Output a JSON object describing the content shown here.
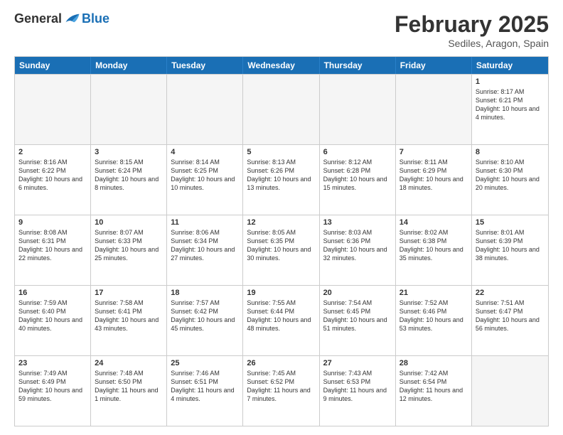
{
  "header": {
    "logo_general": "General",
    "logo_blue": "Blue",
    "month_title": "February 2025",
    "subtitle": "Sediles, Aragon, Spain"
  },
  "days_of_week": [
    "Sunday",
    "Monday",
    "Tuesday",
    "Wednesday",
    "Thursday",
    "Friday",
    "Saturday"
  ],
  "weeks": [
    [
      {
        "day": "",
        "empty": true
      },
      {
        "day": "",
        "empty": true
      },
      {
        "day": "",
        "empty": true
      },
      {
        "day": "",
        "empty": true
      },
      {
        "day": "",
        "empty": true
      },
      {
        "day": "",
        "empty": true
      },
      {
        "day": "1",
        "sunrise": "Sunrise: 8:17 AM",
        "sunset": "Sunset: 6:21 PM",
        "daylight": "Daylight: 10 hours and 4 minutes."
      }
    ],
    [
      {
        "day": "2",
        "sunrise": "Sunrise: 8:16 AM",
        "sunset": "Sunset: 6:22 PM",
        "daylight": "Daylight: 10 hours and 6 minutes."
      },
      {
        "day": "3",
        "sunrise": "Sunrise: 8:15 AM",
        "sunset": "Sunset: 6:24 PM",
        "daylight": "Daylight: 10 hours and 8 minutes."
      },
      {
        "day": "4",
        "sunrise": "Sunrise: 8:14 AM",
        "sunset": "Sunset: 6:25 PM",
        "daylight": "Daylight: 10 hours and 10 minutes."
      },
      {
        "day": "5",
        "sunrise": "Sunrise: 8:13 AM",
        "sunset": "Sunset: 6:26 PM",
        "daylight": "Daylight: 10 hours and 13 minutes."
      },
      {
        "day": "6",
        "sunrise": "Sunrise: 8:12 AM",
        "sunset": "Sunset: 6:28 PM",
        "daylight": "Daylight: 10 hours and 15 minutes."
      },
      {
        "day": "7",
        "sunrise": "Sunrise: 8:11 AM",
        "sunset": "Sunset: 6:29 PM",
        "daylight": "Daylight: 10 hours and 18 minutes."
      },
      {
        "day": "8",
        "sunrise": "Sunrise: 8:10 AM",
        "sunset": "Sunset: 6:30 PM",
        "daylight": "Daylight: 10 hours and 20 minutes."
      }
    ],
    [
      {
        "day": "9",
        "sunrise": "Sunrise: 8:08 AM",
        "sunset": "Sunset: 6:31 PM",
        "daylight": "Daylight: 10 hours and 22 minutes."
      },
      {
        "day": "10",
        "sunrise": "Sunrise: 8:07 AM",
        "sunset": "Sunset: 6:33 PM",
        "daylight": "Daylight: 10 hours and 25 minutes."
      },
      {
        "day": "11",
        "sunrise": "Sunrise: 8:06 AM",
        "sunset": "Sunset: 6:34 PM",
        "daylight": "Daylight: 10 hours and 27 minutes."
      },
      {
        "day": "12",
        "sunrise": "Sunrise: 8:05 AM",
        "sunset": "Sunset: 6:35 PM",
        "daylight": "Daylight: 10 hours and 30 minutes."
      },
      {
        "day": "13",
        "sunrise": "Sunrise: 8:03 AM",
        "sunset": "Sunset: 6:36 PM",
        "daylight": "Daylight: 10 hours and 32 minutes."
      },
      {
        "day": "14",
        "sunrise": "Sunrise: 8:02 AM",
        "sunset": "Sunset: 6:38 PM",
        "daylight": "Daylight: 10 hours and 35 minutes."
      },
      {
        "day": "15",
        "sunrise": "Sunrise: 8:01 AM",
        "sunset": "Sunset: 6:39 PM",
        "daylight": "Daylight: 10 hours and 38 minutes."
      }
    ],
    [
      {
        "day": "16",
        "sunrise": "Sunrise: 7:59 AM",
        "sunset": "Sunset: 6:40 PM",
        "daylight": "Daylight: 10 hours and 40 minutes."
      },
      {
        "day": "17",
        "sunrise": "Sunrise: 7:58 AM",
        "sunset": "Sunset: 6:41 PM",
        "daylight": "Daylight: 10 hours and 43 minutes."
      },
      {
        "day": "18",
        "sunrise": "Sunrise: 7:57 AM",
        "sunset": "Sunset: 6:42 PM",
        "daylight": "Daylight: 10 hours and 45 minutes."
      },
      {
        "day": "19",
        "sunrise": "Sunrise: 7:55 AM",
        "sunset": "Sunset: 6:44 PM",
        "daylight": "Daylight: 10 hours and 48 minutes."
      },
      {
        "day": "20",
        "sunrise": "Sunrise: 7:54 AM",
        "sunset": "Sunset: 6:45 PM",
        "daylight": "Daylight: 10 hours and 51 minutes."
      },
      {
        "day": "21",
        "sunrise": "Sunrise: 7:52 AM",
        "sunset": "Sunset: 6:46 PM",
        "daylight": "Daylight: 10 hours and 53 minutes."
      },
      {
        "day": "22",
        "sunrise": "Sunrise: 7:51 AM",
        "sunset": "Sunset: 6:47 PM",
        "daylight": "Daylight: 10 hours and 56 minutes."
      }
    ],
    [
      {
        "day": "23",
        "sunrise": "Sunrise: 7:49 AM",
        "sunset": "Sunset: 6:49 PM",
        "daylight": "Daylight: 10 hours and 59 minutes."
      },
      {
        "day": "24",
        "sunrise": "Sunrise: 7:48 AM",
        "sunset": "Sunset: 6:50 PM",
        "daylight": "Daylight: 11 hours and 1 minute."
      },
      {
        "day": "25",
        "sunrise": "Sunrise: 7:46 AM",
        "sunset": "Sunset: 6:51 PM",
        "daylight": "Daylight: 11 hours and 4 minutes."
      },
      {
        "day": "26",
        "sunrise": "Sunrise: 7:45 AM",
        "sunset": "Sunset: 6:52 PM",
        "daylight": "Daylight: 11 hours and 7 minutes."
      },
      {
        "day": "27",
        "sunrise": "Sunrise: 7:43 AM",
        "sunset": "Sunset: 6:53 PM",
        "daylight": "Daylight: 11 hours and 9 minutes."
      },
      {
        "day": "28",
        "sunrise": "Sunrise: 7:42 AM",
        "sunset": "Sunset: 6:54 PM",
        "daylight": "Daylight: 11 hours and 12 minutes."
      },
      {
        "day": "",
        "empty": true
      }
    ]
  ]
}
